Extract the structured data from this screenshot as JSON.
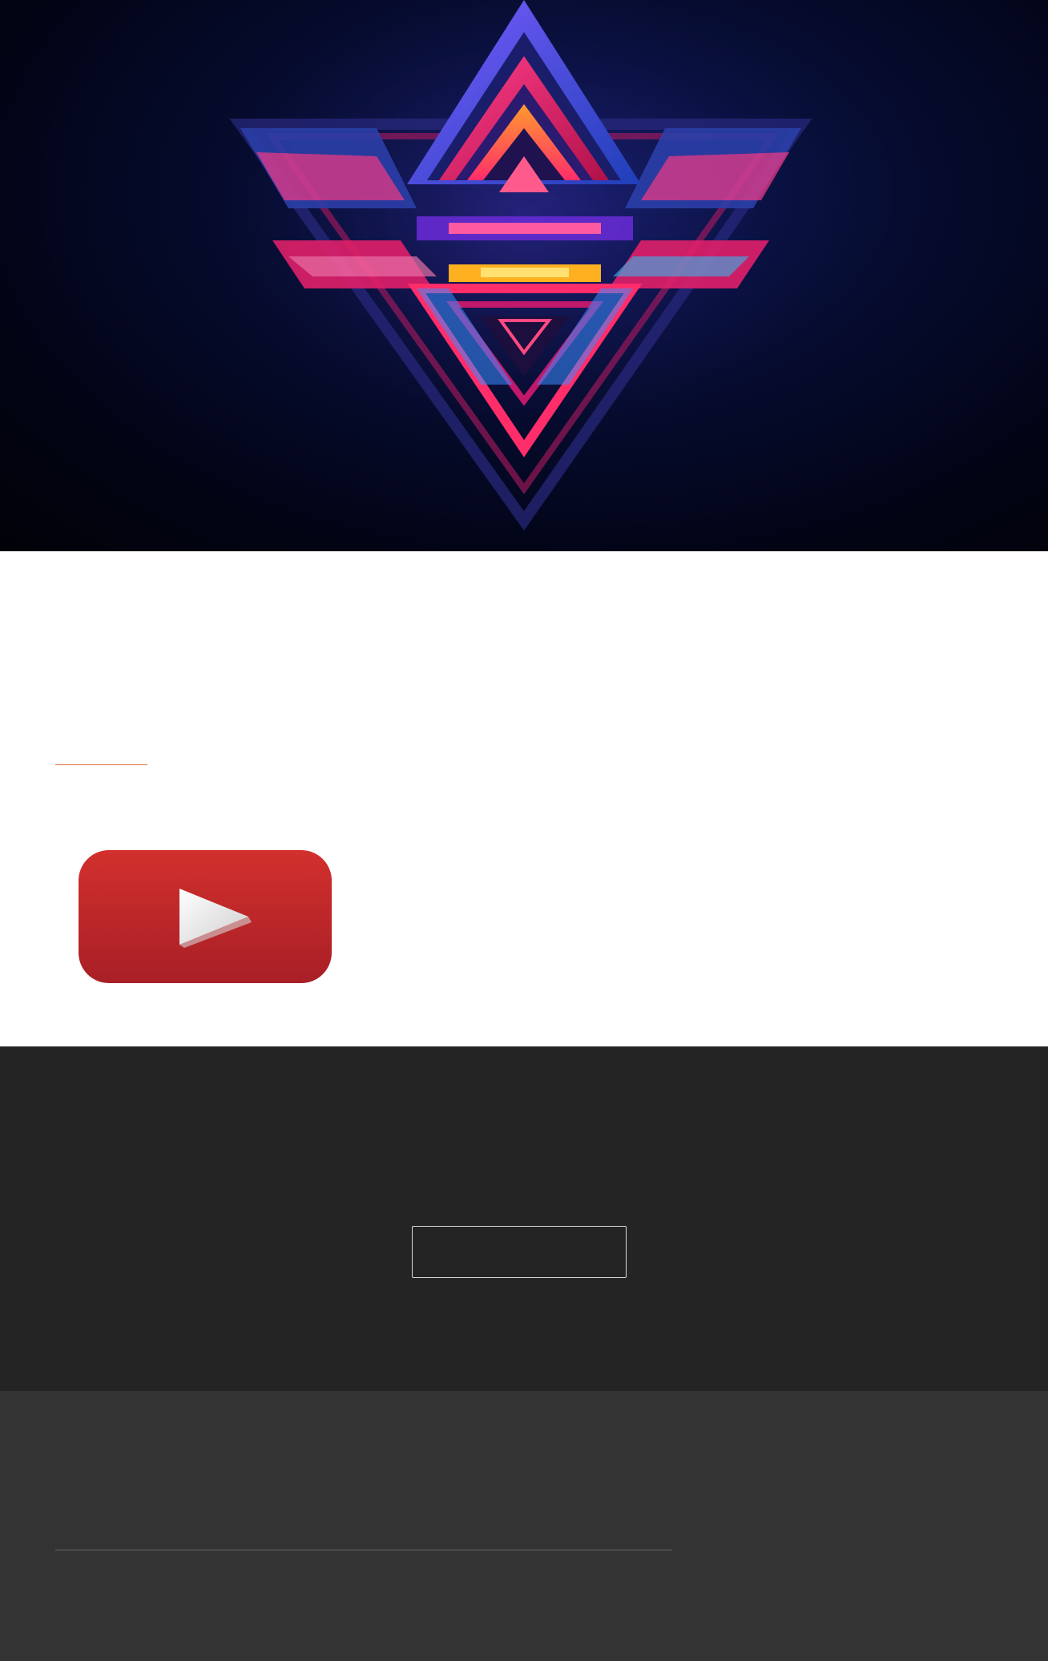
{
  "hero": {
    "image_icon": "abstract-triangle-art",
    "colors": {
      "background": "#040a2a",
      "accent_pink": "#ff2d78",
      "accent_blue": "#3b6cff",
      "accent_orange": "#ffb020"
    }
  },
  "content": {
    "accent_color": "#e0703a",
    "youtube_icon": "youtube-play-icon",
    "youtube_red": "#c4272b"
  },
  "cta": {
    "button_label": "",
    "background": "#242424"
  },
  "footer": {
    "background": "#333333"
  }
}
